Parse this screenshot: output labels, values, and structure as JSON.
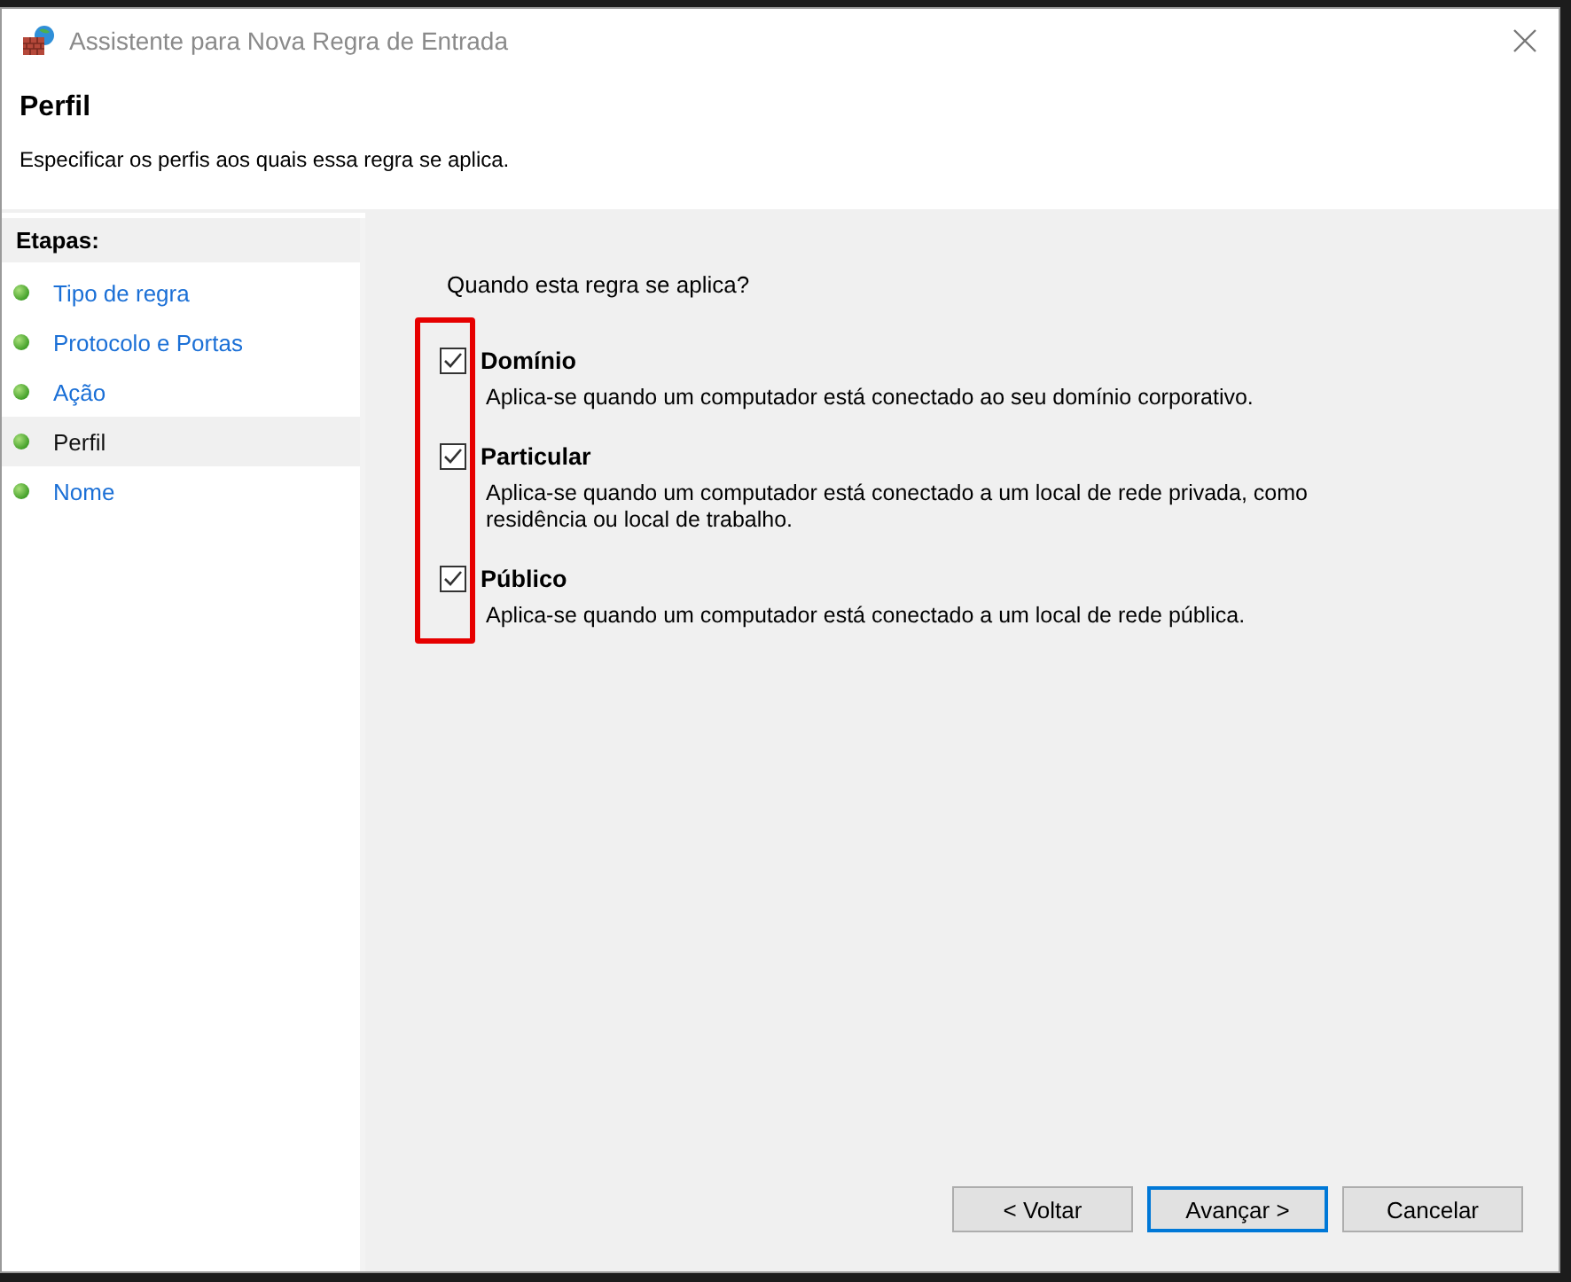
{
  "window": {
    "title": "Assistente para Nova Regra de Entrada"
  },
  "header": {
    "title": "Perfil",
    "subtitle": "Especificar os perfis aos quais essa regra se aplica."
  },
  "steps": {
    "heading": "Etapas:",
    "items": [
      {
        "label": "Tipo de regra",
        "selected": false
      },
      {
        "label": "Protocolo e Portas",
        "selected": false
      },
      {
        "label": "Ação",
        "selected": false
      },
      {
        "label": "Perfil",
        "selected": true
      },
      {
        "label": "Nome",
        "selected": false
      }
    ]
  },
  "question": "Quando esta regra se aplica?",
  "profiles": [
    {
      "label": "Domínio",
      "checked": true,
      "description": "Aplica-se quando um computador está conectado ao seu domínio corporativo."
    },
    {
      "label": "Particular",
      "checked": true,
      "description": "Aplica-se quando um computador está conectado a um local de rede privada, como residência ou local de trabalho."
    },
    {
      "label": "Público",
      "checked": true,
      "description": "Aplica-se quando um computador está conectado a um local de rede pública."
    }
  ],
  "buttons": [
    {
      "label": "< Voltar",
      "default": false
    },
    {
      "label": "Avançar >",
      "default": true
    },
    {
      "label": "Cancelar",
      "default": false
    }
  ]
}
